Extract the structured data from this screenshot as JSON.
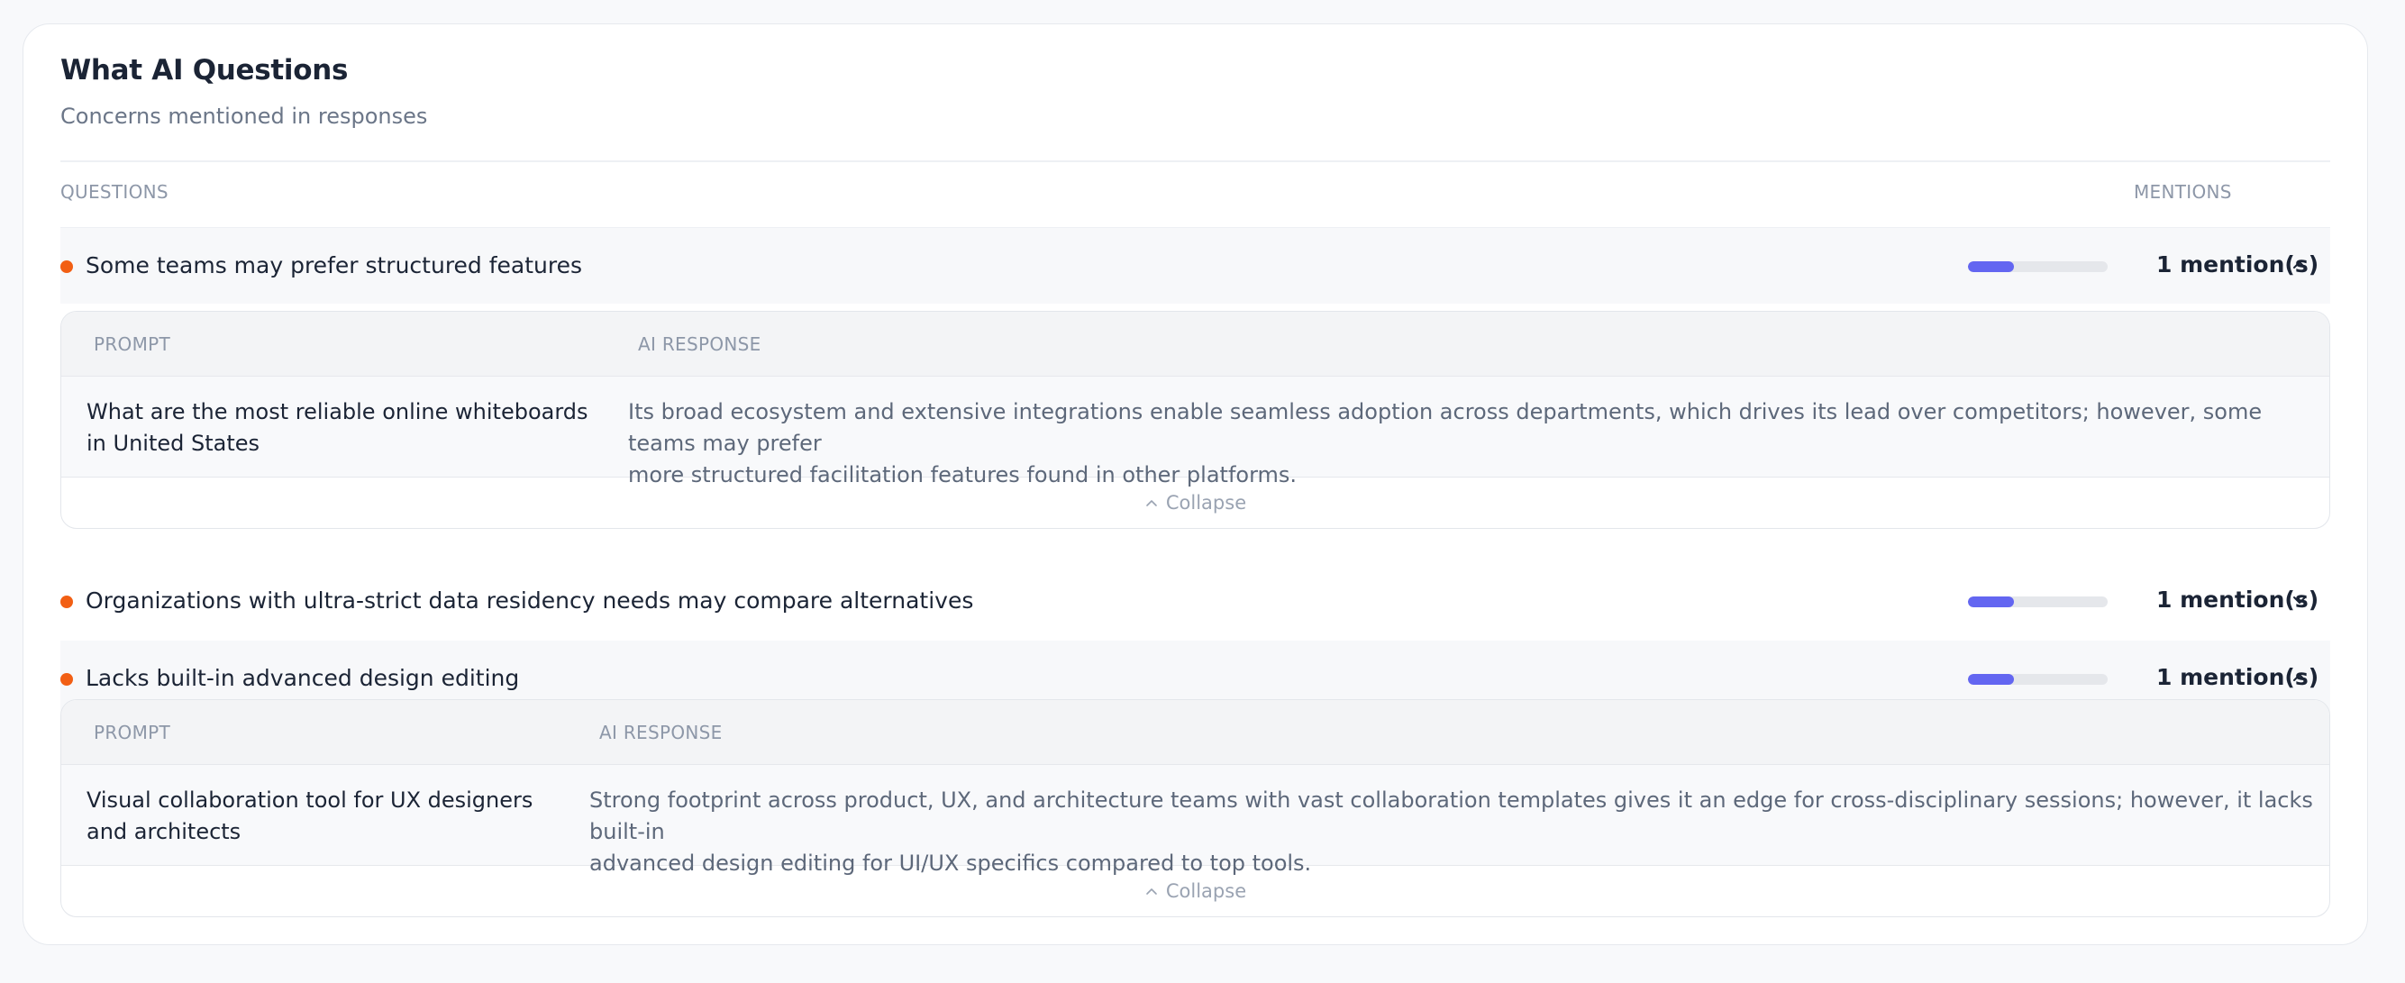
{
  "header": {
    "title": "What AI Questions",
    "subtitle": "Concerns mentioned in responses"
  },
  "columns": {
    "questions": "QUESTIONS",
    "mentions": "MENTIONS"
  },
  "colors": {
    "dot": "#f25f14",
    "bar_fill": "#6366f1",
    "bar_track": "#e5e7eb"
  },
  "rows": [
    {
      "label": "Some teams may prefer structured features",
      "mentions": "1 mention(s)",
      "share": 0.33,
      "expanded": true,
      "chevron": "chevron-up-icon",
      "detail": {
        "prompt_header": "PROMPT",
        "response_header": "AI RESPONSE",
        "prompt_lines": [
          "What are the most reliable online whiteboards",
          "in United States"
        ],
        "response_lines": [
          "Its broad ecosystem and extensive integrations enable seamless adoption across departments, which drives its lead over competitors; however, some teams may prefer",
          "more structured facilitation features found in other platforms."
        ],
        "collapse_label": "Collapse"
      }
    },
    {
      "label": "Organizations with ultra-strict data residency needs may compare alternatives",
      "mentions": "1 mention(s)",
      "share": 0.33,
      "expanded": false,
      "chevron": "chevron-down-icon"
    },
    {
      "label": "Lacks built-in advanced design editing",
      "mentions": "1 mention(s)",
      "share": 0.33,
      "expanded": true,
      "chevron": "chevron-up-icon",
      "detail": {
        "prompt_header": "PROMPT",
        "response_header": "AI RESPONSE",
        "prompt_lines": [
          "Visual collaboration tool for UX designers",
          "and architects"
        ],
        "response_lines": [
          "Strong footprint across product, UX, and architecture teams with vast collaboration templates gives it an edge for cross-disciplinary sessions; however, it lacks built-in",
          "advanced design editing for UI/UX specifics compared to top tools."
        ],
        "collapse_label": "Collapse"
      }
    }
  ]
}
